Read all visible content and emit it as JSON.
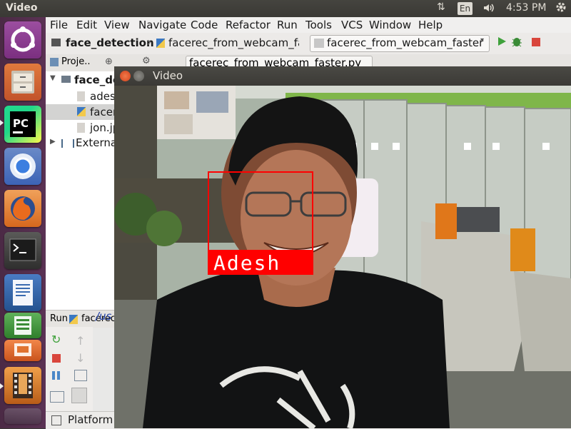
{
  "top_panel": {
    "window_title": "Video",
    "language": "En",
    "clock": "4:53 PM"
  },
  "launcher": {
    "items": [
      "ubuntu-dash",
      "files",
      "pycharm",
      "chromium",
      "firefox",
      "terminal",
      "libreoffice-writer",
      "libreoffice-calc",
      "libreoffice-impress",
      "video"
    ]
  },
  "ide": {
    "menu": [
      "File",
      "Edit",
      "View",
      "Navigate",
      "Code",
      "Refactor",
      "Run",
      "Tools",
      "VCS",
      "Window",
      "Help"
    ],
    "breadcrumb": {
      "project": "face_detection",
      "file": "facerec_from_webcam_fas"
    },
    "run_config": "facerec_from_webcam_faster",
    "project_tool_label": "Proje..",
    "editor_tab": "facerec_from_webcam_faster.py",
    "tree": {
      "root": "face_de",
      "items": [
        "ades",
        "facer",
        "jon.jp"
      ],
      "external": "Externa"
    },
    "run": {
      "label": "Run",
      "config": "facerec",
      "output_fragment": "/us"
    },
    "bottom": {
      "platform": "Platform"
    }
  },
  "video_window": {
    "title": "Video",
    "detection": {
      "name": "Adesh",
      "box_color": "#ff0000"
    }
  },
  "colors": {
    "launcher_bg": "#5b3254",
    "panel_bg": "#3c3b37",
    "detection_red": "#ff0000",
    "run_green": "#3fa13b",
    "stop_red": "#d9463c"
  }
}
